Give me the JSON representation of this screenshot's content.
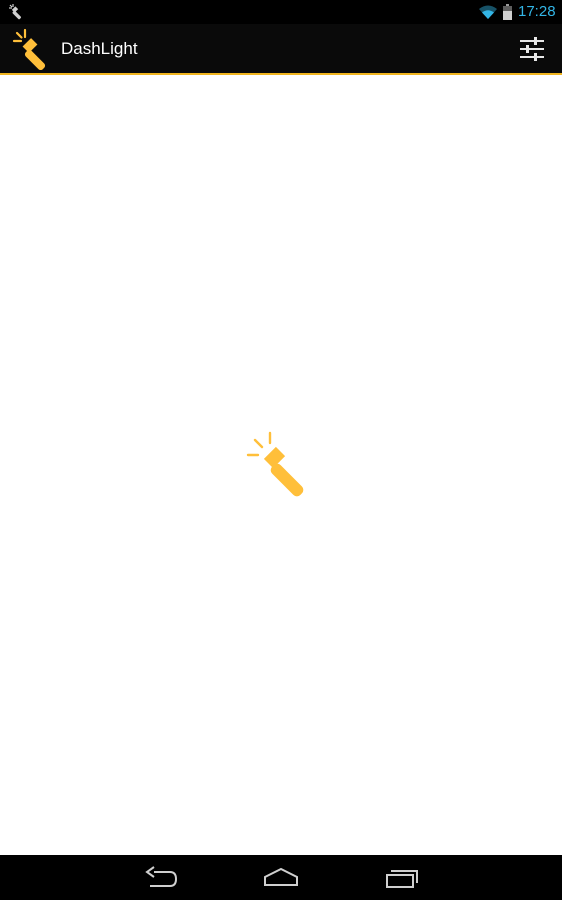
{
  "status_bar": {
    "time": "17:28",
    "notification_icon": "flashlight-icon",
    "wifi_icon": "wifi-icon",
    "battery_icon": "battery-icon",
    "accent_color": "#33b5e5"
  },
  "action_bar": {
    "app_icon": "flashlight-icon",
    "title": "DashLight",
    "settings_icon": "sliders-icon",
    "accent_color": "#f0b51f"
  },
  "main": {
    "toggle_icon": "flashlight-icon",
    "icon_color": "#ffbf3a"
  },
  "nav_bar": {
    "back_icon": "back-icon",
    "home_icon": "home-icon",
    "recents_icon": "recents-icon"
  }
}
